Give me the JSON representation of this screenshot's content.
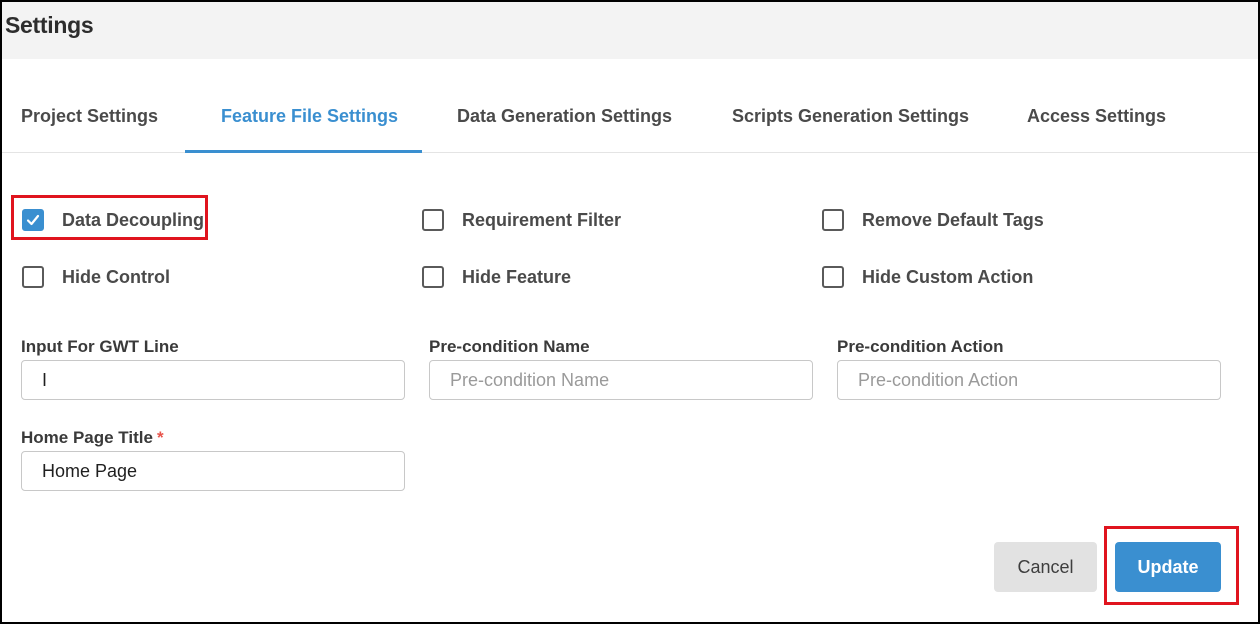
{
  "header": {
    "title": "Settings"
  },
  "tabs": [
    {
      "label": "Project Settings",
      "active": false
    },
    {
      "label": "Feature File Settings",
      "active": true
    },
    {
      "label": "Data Generation Settings",
      "active": false
    },
    {
      "label": "Scripts Generation Settings",
      "active": false
    },
    {
      "label": "Access Settings",
      "active": false
    }
  ],
  "options": {
    "data_decoupling": {
      "label": "Data Decoupling",
      "checked": true
    },
    "requirement_filter": {
      "label": "Requirement Filter",
      "checked": false
    },
    "remove_default_tags": {
      "label": "Remove Default Tags",
      "checked": false
    },
    "hide_control": {
      "label": "Hide Control",
      "checked": false
    },
    "hide_feature": {
      "label": "Hide Feature",
      "checked": false
    },
    "hide_custom_action": {
      "label": "Hide Custom Action",
      "checked": false
    }
  },
  "fields": {
    "gwt_line": {
      "label": "Input For GWT Line",
      "value": "I",
      "placeholder": ""
    },
    "precondition_name": {
      "label": "Pre-condition Name",
      "value": "",
      "placeholder": "Pre-condition Name"
    },
    "precondition_action": {
      "label": "Pre-condition Action",
      "value": "",
      "placeholder": "Pre-condition Action"
    },
    "home_page_title": {
      "label": "Home Page Title",
      "required_mark": "*",
      "value": "Home Page",
      "placeholder": ""
    }
  },
  "actions": {
    "cancel_label": "Cancel",
    "update_label": "Update"
  },
  "colors": {
    "accent": "#3a8fd0",
    "highlight": "#e0141e",
    "required": "#e8534a"
  },
  "icons": {
    "checkbox_checked": "check-icon"
  }
}
